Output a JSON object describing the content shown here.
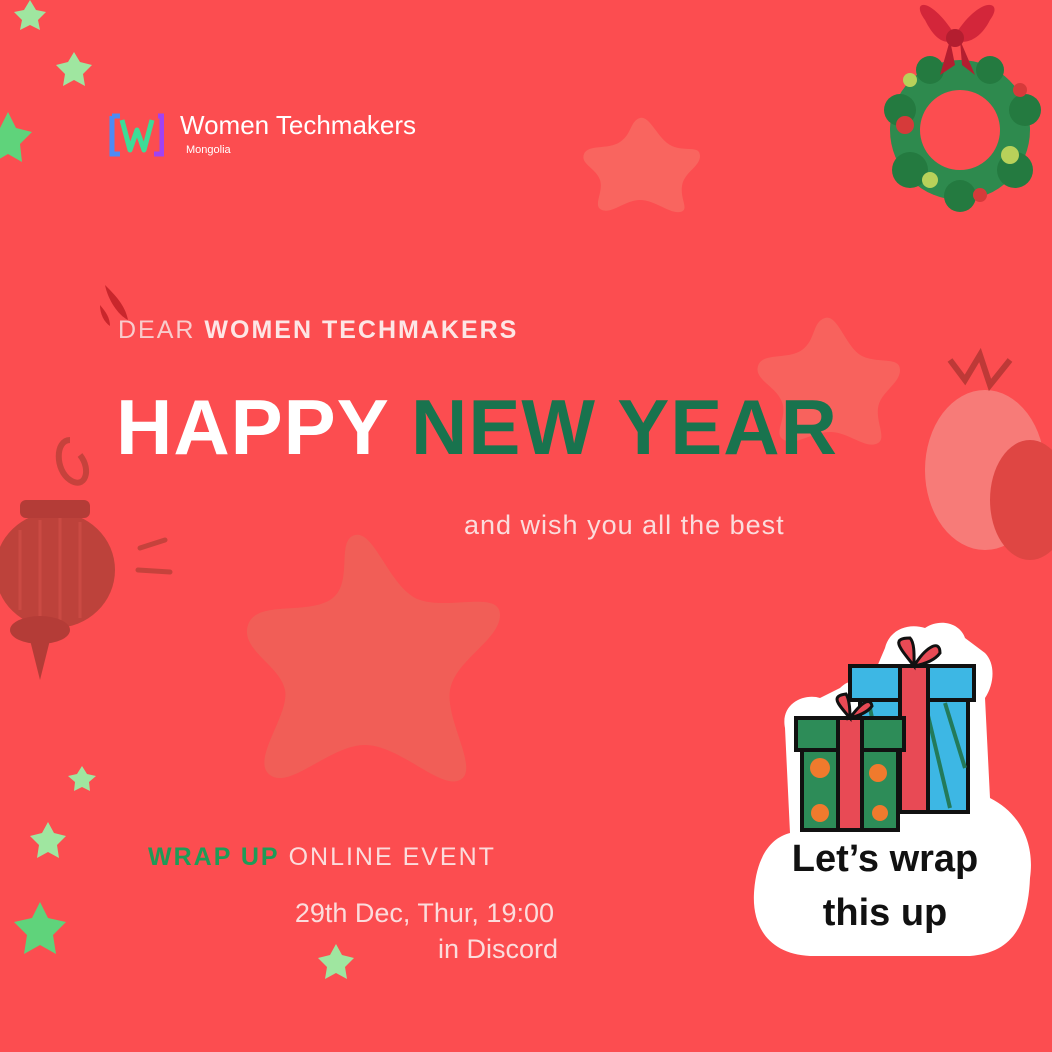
{
  "brand": {
    "name": "Women Techmakers",
    "chapter": "Mongolia"
  },
  "greeting": {
    "dear": "DEAR",
    "audience": "WOMEN TECHMAKERS",
    "headline_part1": "HAPPY",
    "headline_part2": "NEW YEAR",
    "wish": "and wish you all the best"
  },
  "event": {
    "highlight": "WRAP UP",
    "label": "ONLINE EVENT",
    "datetime": "29th Dec, Thur, 19:00",
    "location": "in Discord"
  },
  "sticker": {
    "line1": "Let’s wrap",
    "line2": "this up"
  },
  "colors": {
    "background": "#fc4d50",
    "accent_green": "#19734e",
    "star_green": "#9fe6a0",
    "text_light": "#fbdcdc"
  },
  "icons": [
    "wreath-icon",
    "gift-boxes-icon",
    "ornament-icon",
    "star-icon",
    "wtm-logo-icon"
  ]
}
